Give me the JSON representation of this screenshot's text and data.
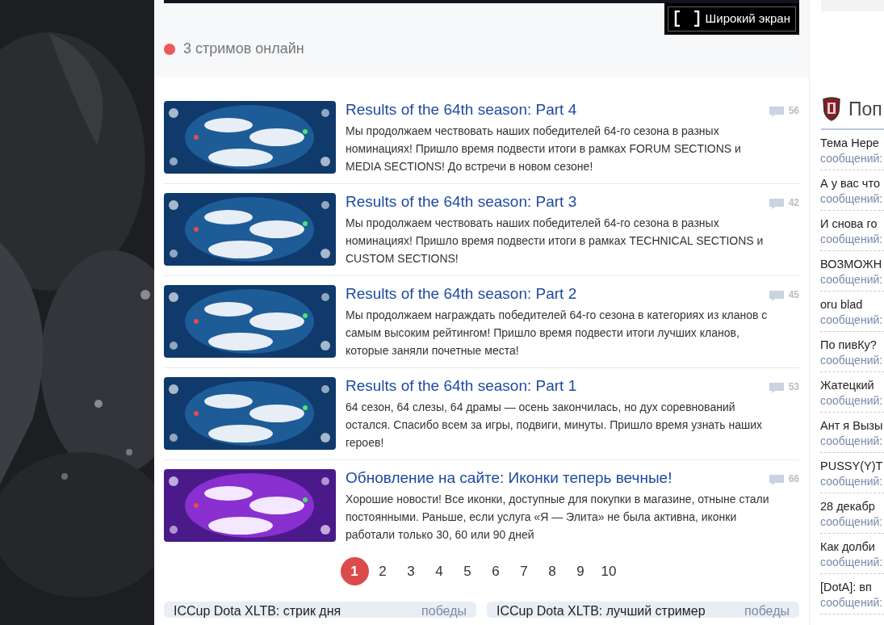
{
  "player": {
    "widescreen_button": "Широкий экран"
  },
  "streams_online": "3 стримов онлайн",
  "news": [
    {
      "kind": "season-banner",
      "title": "Results of the 64th season: Part 4",
      "comments": "56",
      "text": "Мы продолжаем чествовать наших победителей 64-го сезона в разных номинациях! Пришло время подвести итоги в рамках FORUM SECTIONS и MEDIA SECTIONS! До встречи в новом сезоне!"
    },
    {
      "kind": "season-banner",
      "title": "Results of the 64th season: Part 3",
      "comments": "42",
      "text": "Мы продолжаем чествовать наших победителей 64-го сезона в разных номинациях! Пришло время подвести итоги в рамках TECHNICAL SECTIONS и CUSTOM SECTIONS!"
    },
    {
      "kind": "season-banner",
      "title": "Results of the 64th season: Part 2",
      "comments": "45",
      "text": "Мы продолжаем награждать победителей 64-го сезона в категориях из кланов с самым высоким рейтингом! Пришло время подвести итоги лучших кланов, которые заняли почетные места!"
    },
    {
      "kind": "season-banner",
      "title": "Results of the 64th season: Part 1",
      "comments": "53",
      "text": "64 сезон, 64 слезы, 64 драмы — осень закончилась, но дух соревнований остался. Спасибо всем за игры, подвиги, минуты. Пришло время узнать наших героев!"
    },
    {
      "kind": "update-banner",
      "title": "Обновление на сайте: Иконки теперь вечные!",
      "comments": "66",
      "text": "Хорошие новости! Все иконки, доступные для покупки в магазине, отныне стали постоянными. Раньше, если услуга «Я — Элита» не была активна, иконки работали только 30, 60 или 90 дней"
    }
  ],
  "pagination": [
    {
      "label": "1",
      "selected": true
    },
    {
      "label": "2",
      "selected": false
    },
    {
      "label": "3",
      "selected": false
    },
    {
      "label": "4",
      "selected": false
    },
    {
      "label": "5",
      "selected": false
    },
    {
      "label": "6",
      "selected": false
    },
    {
      "label": "7",
      "selected": false
    },
    {
      "label": "8",
      "selected": false
    },
    {
      "label": "9",
      "selected": false
    },
    {
      "label": "10",
      "selected": false
    }
  ],
  "bottom_cards": [
    {
      "title": "ICCup Dota XLTB: стрик дня",
      "tag": "победы"
    },
    {
      "title": "ICCup Dota XLTB: лучший стример",
      "tag": "победы"
    }
  ],
  "sidebar": {
    "title": "Поп",
    "topics": [
      {
        "title": "Тема Нере",
        "meta": "сообщений:"
      },
      {
        "title": "А у вас что",
        "meta": "сообщений:"
      },
      {
        "title": "И снова го",
        "meta": "сообщений:"
      },
      {
        "title": "ВОЗМОЖН",
        "meta": "сообщений:"
      },
      {
        "title": "oru blad",
        "meta": "сообщений:"
      },
      {
        "title": "По пивКу?",
        "meta": "сообщений:"
      },
      {
        "title": "Жатецкий",
        "meta": "сообщений:"
      },
      {
        "title": "Ант я Вызы",
        "meta": "сообщений:"
      },
      {
        "title": "PUSSY(Y)T",
        "meta": "сообщений:"
      },
      {
        "title": "28 декабр",
        "meta": "сообщений:"
      },
      {
        "title": "Как долби",
        "meta": "сообщений:"
      },
      {
        "title": "[DotA]: вп",
        "meta": "сообщений:"
      }
    ]
  }
}
